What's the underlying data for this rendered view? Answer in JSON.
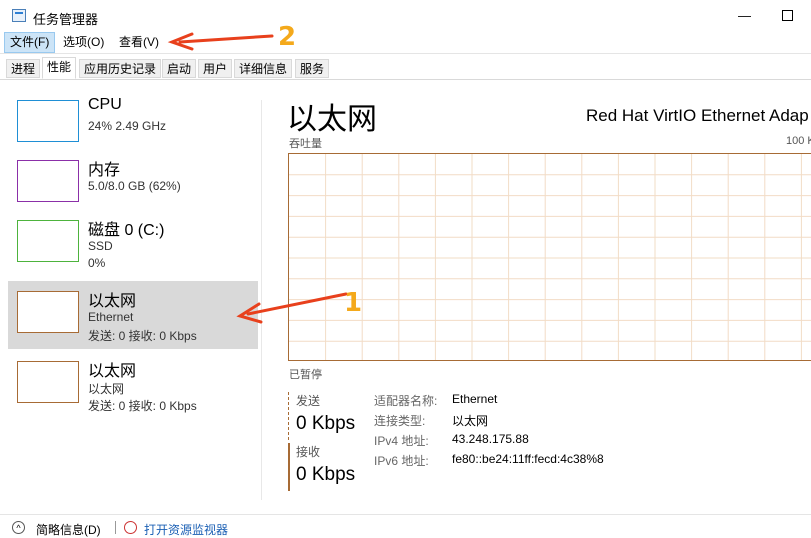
{
  "window": {
    "title": "任务管理器",
    "minimize_glyph": "—",
    "maximize_glyph": ""
  },
  "menu": {
    "items": [
      "文件(F)",
      "选项(O)",
      "查看(V)"
    ]
  },
  "tabs": [
    "进程",
    "性能",
    "应用历史记录",
    "启动",
    "用户",
    "详细信息",
    "服务"
  ],
  "active_tab": "性能",
  "sidebar": {
    "items": [
      {
        "title": "CPU",
        "line1": "24% 2.49 GHz",
        "line2": "",
        "color": "#1f8fd5",
        "selected": false
      },
      {
        "title": "内存",
        "line1": "5.0/8.0 GB (62%)",
        "line2": "",
        "color": "#8b2fa8",
        "selected": false
      },
      {
        "title": "磁盘 0 (C:)",
        "line1": "SSD",
        "line2": "0%",
        "color": "#4db33d",
        "selected": false
      },
      {
        "title": "以太网",
        "line1": "Ethernet",
        "line2": "发送: 0 接收: 0 Kbps",
        "color": "#a76b35",
        "selected": true
      },
      {
        "title": "以太网",
        "line1": "以太网",
        "line2": "发送: 0 接收: 0 Kbps",
        "color": "#a76b35",
        "selected": false
      }
    ]
  },
  "detail": {
    "title": "以太网",
    "adapter": "Red Hat VirtIO Ethernet Adap",
    "throughput_label": "吞吐量",
    "max_label": "100 K",
    "status": "已暂停",
    "send_label": "发送",
    "send_value": "0 Kbps",
    "recv_label": "接收",
    "recv_value": "0 Kbps",
    "properties": [
      {
        "label": "适配器名称:",
        "value": "Ethernet"
      },
      {
        "label": "连接类型:",
        "value": "以太网"
      },
      {
        "label": "IPv4 地址:",
        "value": "43.248.175.88"
      },
      {
        "label": "IPv6 地址:",
        "value": "fe80::be24:11ff:fecd:4c38%8"
      }
    ]
  },
  "footer": {
    "summary": "简略信息(D)",
    "monitor_link": "打开资源监视器"
  },
  "annotations": {
    "label1": "1",
    "label2": "2",
    "arrow_color": "#e8401c"
  },
  "graph_color": "#a76b35"
}
